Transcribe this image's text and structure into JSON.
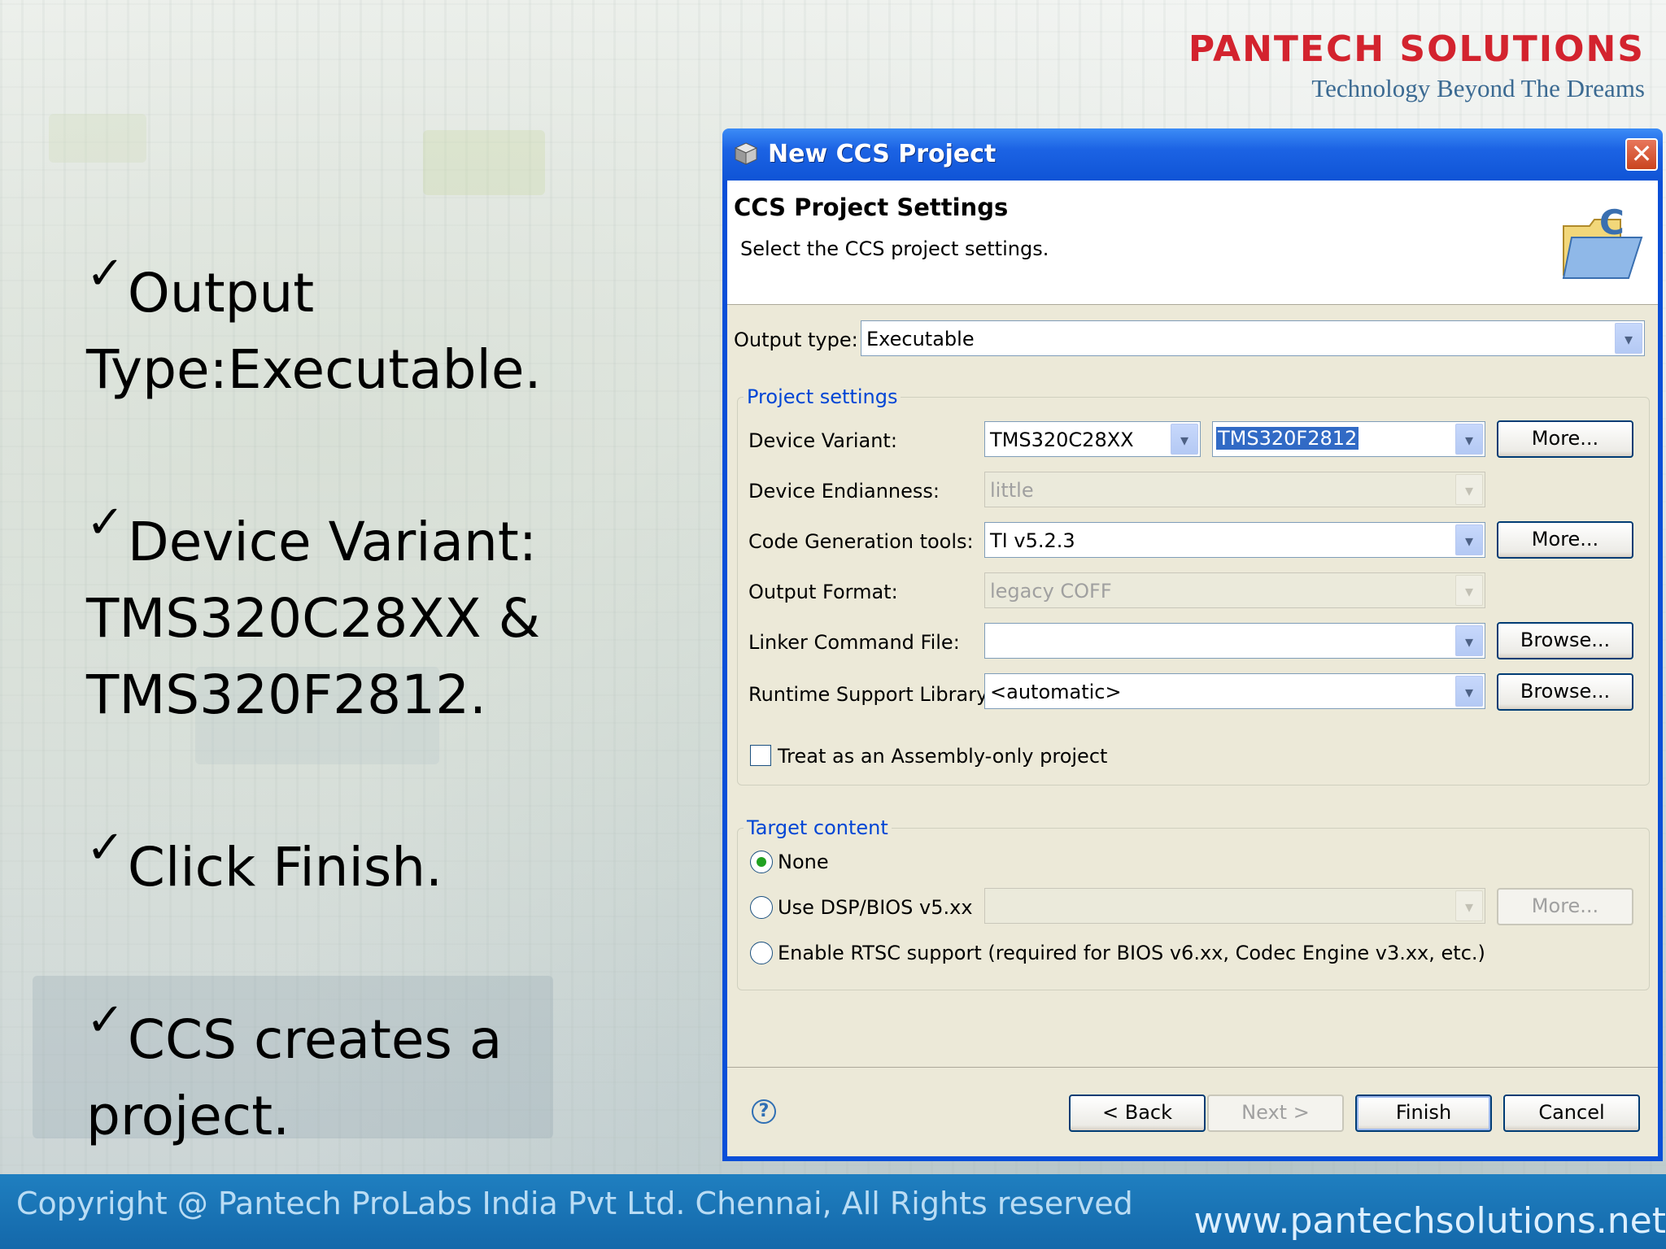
{
  "logo": {
    "name": "PANTECH SOLUTIONS",
    "tagline": "Technology Beyond The Dreams"
  },
  "bullets": [
    {
      "check": "✓",
      "text": "Output Type:Executable."
    },
    {
      "check": "✓",
      "text": "Device Variant: TMS320C28XX & TMS320F2812."
    },
    {
      "check": "✓",
      "text": "Click Finish."
    },
    {
      "check": "✓",
      "text": "CCS creates a project."
    }
  ],
  "footer": {
    "copyright": "Copyright @ Pantech ProLabs India Pvt Ltd. Chennai, All Rights reserved",
    "url": "www.pantechsolutions.net"
  },
  "dialog": {
    "title": "New CCS Project",
    "close_glyph": "✕",
    "header_title": "CCS Project Settings",
    "header_subtitle": "Select the CCS project settings.",
    "output_type": {
      "label": "Output type:",
      "value": "Executable"
    },
    "project_settings": {
      "group_title": "Project settings",
      "device_variant": {
        "label": "Device Variant:",
        "family": "TMS320C28XX",
        "device": "TMS320F2812",
        "more": "More..."
      },
      "device_endianness": {
        "label": "Device Endianness:",
        "value": "little"
      },
      "codegen_tools": {
        "label": "Code Generation tools:",
        "value": "TI v5.2.3",
        "more": "More..."
      },
      "output_format": {
        "label": "Output Format:",
        "value": "legacy COFF"
      },
      "linker_cmd": {
        "label": "Linker Command File:",
        "value": "",
        "browse": "Browse..."
      },
      "runtime_lib": {
        "label": "Runtime Support Library:",
        "value": "<automatic>",
        "browse": "Browse..."
      },
      "assembly_only": {
        "label": "Treat as an Assembly-only project",
        "checked": false
      }
    },
    "target_content": {
      "group_title": "Target content",
      "none": {
        "label": "None",
        "checked": true
      },
      "dspbios": {
        "label": "Use DSP/BIOS v5.xx",
        "checked": false,
        "value": "",
        "more": "More..."
      },
      "rtsc": {
        "label": "Enable RTSC support (required for BIOS v6.xx, Codec Engine v3.xx, etc.)",
        "checked": false
      }
    },
    "buttons": {
      "help": "?",
      "back": "< Back",
      "next": "Next >",
      "finish": "Finish",
      "cancel": "Cancel"
    },
    "arrow_glyph": "▾"
  },
  "icons": [
    "checkmark-icon",
    "ccs-app-icon",
    "close-icon",
    "folder-c-icon",
    "dropdown-arrow-icon",
    "help-icon"
  ],
  "colors": {
    "logo_red": "#d3232e",
    "logo_blue": "#3b6a92",
    "footer_blue": "#1468aa",
    "xp_title_blue": "#1c63e4",
    "group_title_blue": "#0046d5",
    "selection_blue": "#316ac5"
  }
}
